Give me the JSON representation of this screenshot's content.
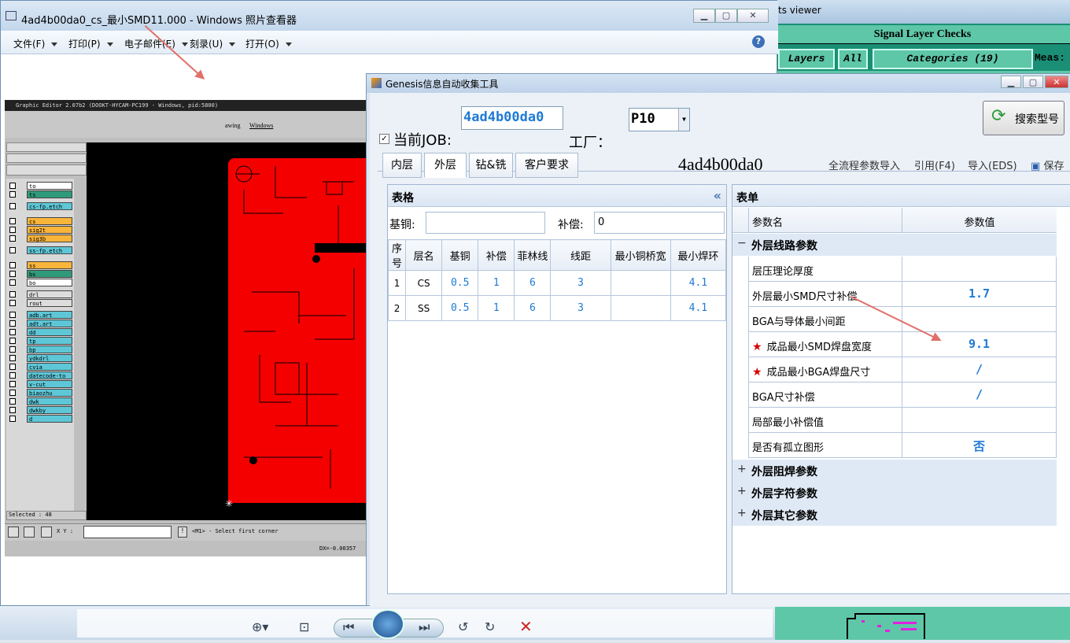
{
  "photo_viewer": {
    "title": "4ad4b00da0_cs_最小SMD11.000 - Windows 照片查看器",
    "menus": [
      "文件(F)",
      "打印(P)",
      "电子邮件(E)",
      "刻录(U)",
      "打开(O)"
    ],
    "help": "?"
  },
  "graphic_editor": {
    "title": "Graphic Editor 2.07b2 (DOOKT-HYCAM-PC199 - Windows, pid:5800)",
    "menu": [
      "awing",
      "Windows"
    ],
    "layers": [
      "to",
      "ts",
      "cs-fp.etch",
      "cs",
      "sig2t",
      "sig3b",
      "ss-fp.etch",
      "ss",
      "bs",
      "bo",
      "drl",
      "rout",
      "adb.art",
      "adt.art",
      "dd",
      "tp",
      "bp",
      "ydkdrl",
      "cvia",
      "datecode-to",
      "v-cut",
      "biaozhu",
      "dwk",
      "dwkby",
      "d"
    ],
    "selected": "Selected : 48",
    "xy_label": "X Y :",
    "hint": "<M1> - Select first corner",
    "dx": "DX=-0.00357"
  },
  "checks_viewer": {
    "title": "ts viewer",
    "header": "Signal Layer Checks",
    "layers_btn": "Layers",
    "all_btn": "All",
    "categories_btn": "Categories (19)",
    "meas": "Meas:"
  },
  "genesis": {
    "title": "Genesis信息自动收集工具",
    "job_label": "当前JOB:",
    "job_value": "4ad4b00da0",
    "factory_label": "工厂：",
    "factory_value": "P10",
    "search_btn": "搜索型号",
    "tabs": [
      "内层",
      "外层",
      "钻&铣",
      "客户要求"
    ],
    "job_display": "4ad4b00da0",
    "links": [
      "全流程参数导入",
      "引用(F4)",
      "导入(EDS)",
      "保存"
    ],
    "table_pane": {
      "title": "表格",
      "collapse": "«",
      "base_copper_label": "基铜:",
      "base_copper_value": "",
      "comp_label": "补偿:",
      "comp_value": "0",
      "columns": [
        "序号",
        "层名",
        "基铜",
        "补偿",
        "菲林线",
        "线距",
        "最小铜桥宽",
        "最小焊环"
      ],
      "rows": [
        [
          "1",
          "CS",
          "0.5",
          "1",
          "6",
          "3",
          "",
          "4.1"
        ],
        [
          "2",
          "SS",
          "0.5",
          "1",
          "6",
          "3",
          "",
          "4.1"
        ]
      ]
    },
    "form_pane": {
      "title": "表单",
      "col_name": "参数名",
      "col_value": "参数值",
      "group_open": "外层线路参数",
      "params": [
        {
          "name": "层压理论厚度",
          "value": "",
          "required": false
        },
        {
          "name": "外层最小SMD尺寸补偿",
          "value": "1.7",
          "required": false
        },
        {
          "name": "BGA与导体最小间距",
          "value": "",
          "required": false
        },
        {
          "name": "成品最小SMD焊盘宽度",
          "value": "9.1",
          "required": true
        },
        {
          "name": "成品最小BGA焊盘尺寸",
          "value": "/",
          "required": true
        },
        {
          "name": "BGA尺寸补偿",
          "value": "/",
          "required": false
        },
        {
          "name": "局部最小补偿值",
          "value": "",
          "required": false
        },
        {
          "name": "是否有孤立图形",
          "value": "否",
          "required": false
        }
      ],
      "groups_closed": [
        "外层阻焊参数",
        "外层字符参数",
        "外层其它参数"
      ]
    }
  },
  "colors": {
    "accent": "#1e7ad4",
    "pcb_red": "#f40000",
    "arrow": "#e0706a",
    "checks_bg": "#5ec7a7"
  }
}
